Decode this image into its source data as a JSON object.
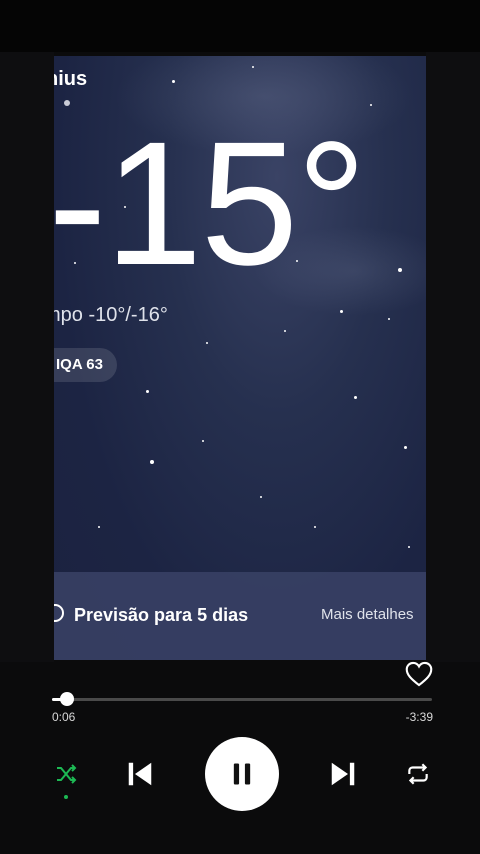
{
  "weather": {
    "city": "nius",
    "temperature": "-15°",
    "range": "mpo  -10°/-16°",
    "aqi": "IQA 63",
    "forecast_title": "Previsão para 5 dias",
    "forecast_more": "Mais detalhes"
  },
  "player": {
    "elapsed": "0:06",
    "remaining": "-3:39",
    "progress_fraction": 0.04,
    "shuffle_active": true,
    "accent": "#1db954"
  }
}
